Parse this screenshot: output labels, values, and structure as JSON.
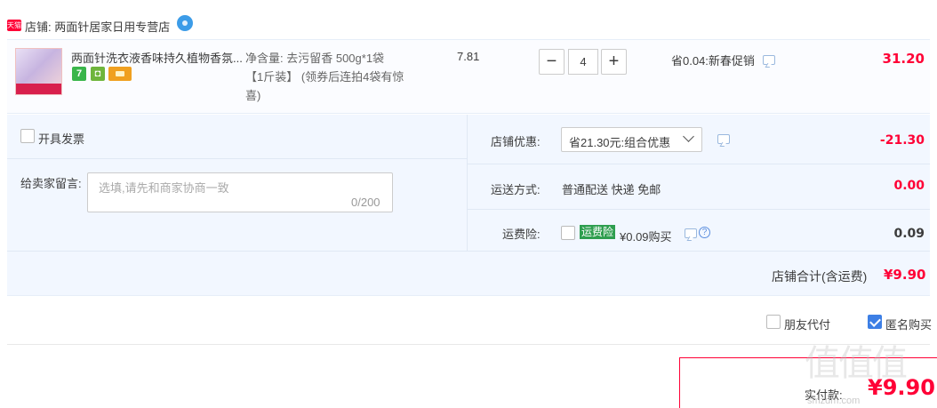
{
  "shop": {
    "badge": "天猫",
    "name": "店铺: 两面针居家日用专营店"
  },
  "item": {
    "title": "两面针洗衣液香味持久植物香氛...",
    "service_icons": [
      "seven-day-return-icon",
      "guarantee-icon",
      "card-payment-icon"
    ],
    "service_7_label": "7",
    "sku_line1": "净含量: 去污留香 500g*1袋",
    "sku_line2": "【1斤装】 (领券后连拍4袋有惊喜)",
    "unit_price": "7.81",
    "quantity": "4",
    "minus_label": "−",
    "plus_label": "+",
    "promo": "省0.04:新春促销",
    "total": "31.20"
  },
  "options": {
    "invoice_label": "开具发票",
    "invoice_checked": false,
    "message_label": "给卖家留言:",
    "message_placeholder": "选填,请先和商家协商一致",
    "message_count": "0/200",
    "shop_discount_label": "店铺优惠:",
    "shop_discount_select": "省21.30元:组合优惠",
    "shop_discount_value": "-21.30",
    "shipping_label": "运送方式:",
    "shipping_value": "普通配送 快递 免邮",
    "shipping_cost": "0.00",
    "insurance_label": "运费险:",
    "insurance_badge": "运费险",
    "insurance_price": "¥0.09购买",
    "insurance_checked": false,
    "insurance_cost": "0.09",
    "help_glyph": "?"
  },
  "summary": {
    "shop_total_label": "店铺合计(含运费)",
    "shop_total_value": "¥9.90",
    "friend_pay_label": "朋友代付",
    "friend_pay_checked": false,
    "anonymous_label": "匿名购买",
    "anonymous_checked": true,
    "pay_label": "实付款:",
    "pay_value": "¥9.90"
  },
  "watermark": {
    "logo": "值值值",
    "site": "smzdm.com"
  },
  "colors": {
    "accent_red": "#ff0036",
    "panel_blue": "#f2f7ff",
    "checkbox_blue": "#3d7fe5",
    "insurance_green": "#2e9e4f"
  }
}
